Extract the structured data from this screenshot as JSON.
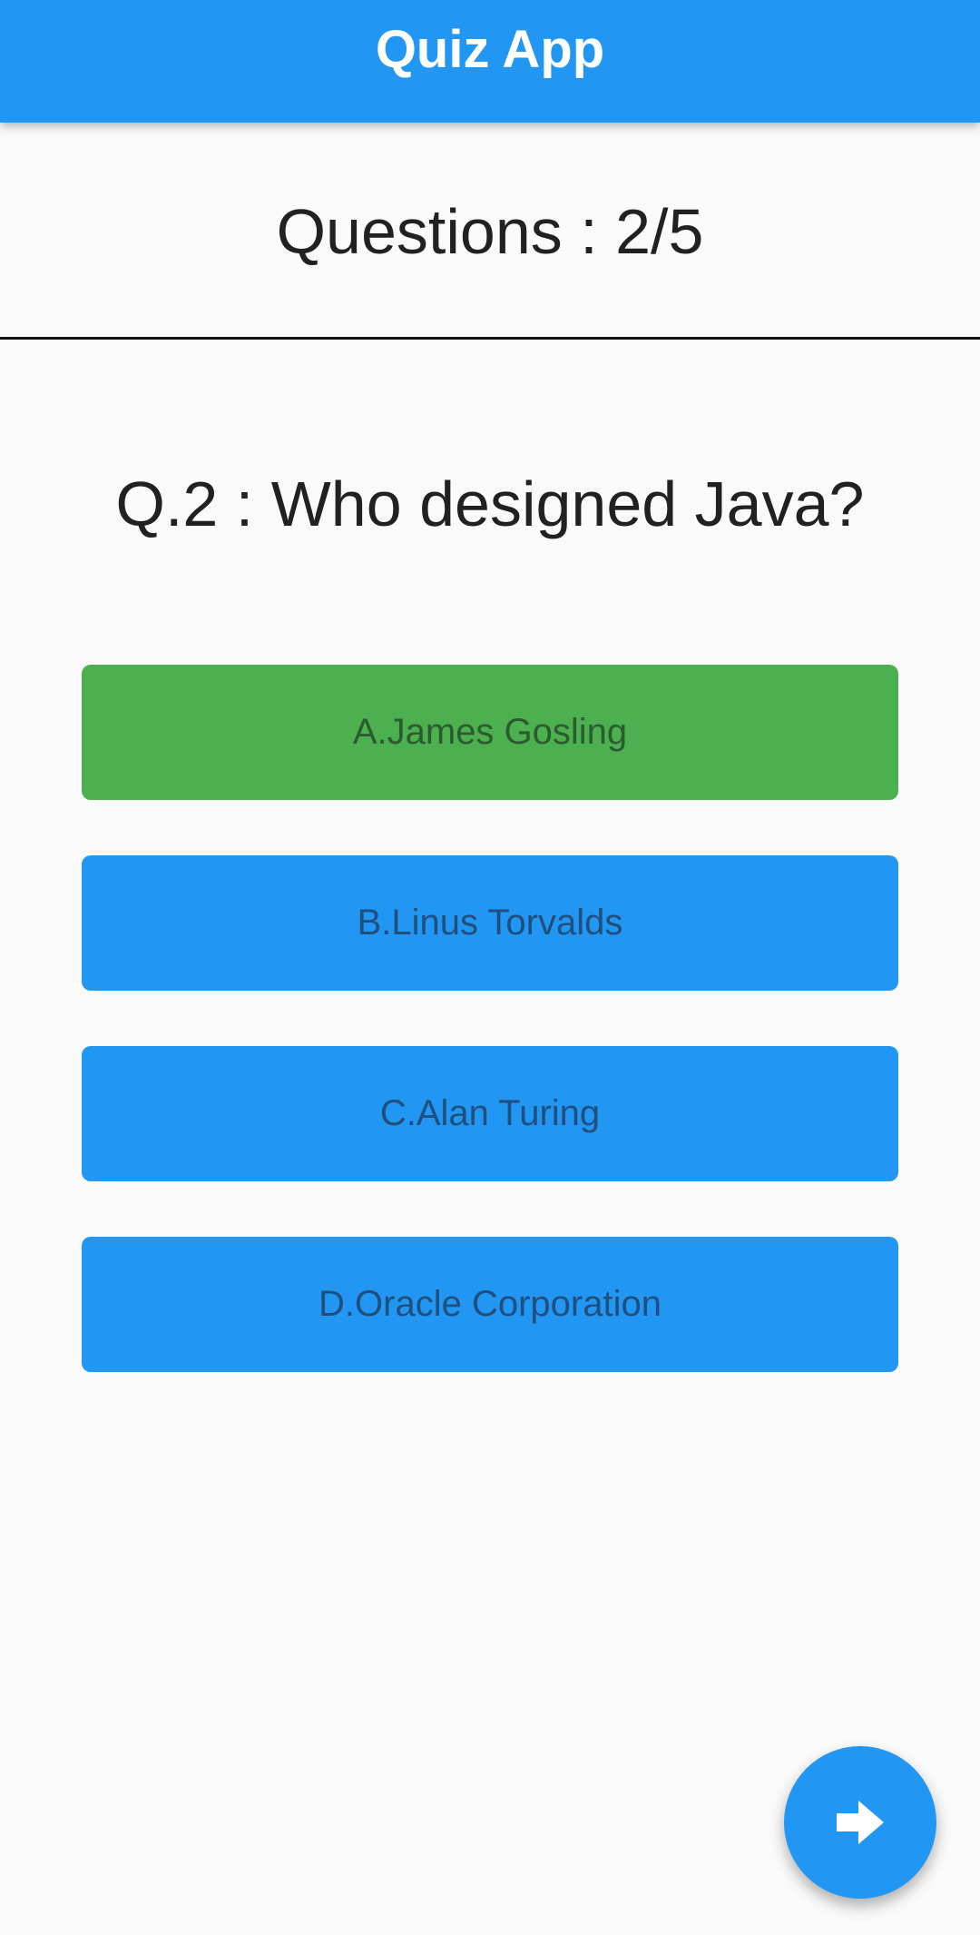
{
  "app_bar": {
    "title": "Quiz App",
    "color": "#2196f3"
  },
  "progress": {
    "label": "Questions : 2/5",
    "current": 2,
    "total": 5
  },
  "question": {
    "text": "Q.2 : Who designed Java?"
  },
  "options": [
    {
      "label": "A.James Gosling",
      "state": "correct",
      "color": "#4caf50"
    },
    {
      "label": "B.Linus Torvalds",
      "state": "default",
      "color": "#2196f3"
    },
    {
      "label": "C.Alan Turing",
      "state": "default",
      "color": "#2196f3"
    },
    {
      "label": "D.Oracle Corporation",
      "state": "default",
      "color": "#2196f3"
    }
  ],
  "fab": {
    "icon": "arrow-forward-icon",
    "color": "#2196f3"
  }
}
